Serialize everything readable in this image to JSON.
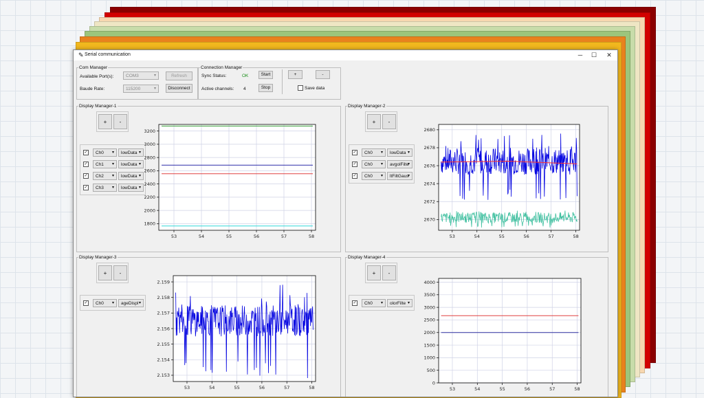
{
  "window": {
    "title": "Serial communication",
    "icon": "feather-icon",
    "minimize": "─",
    "maximize": "☐",
    "close": "✕"
  },
  "com_manager": {
    "legend": "Com Manager",
    "ports_label": "Available Port(s):",
    "port_value": "COM3",
    "refresh": "Refresh",
    "baud_label": "Baude Rate:",
    "baud_value": "115200",
    "disconnect": "Disconnect"
  },
  "connection_manager": {
    "legend": "Connection Manager",
    "sync_label": "Sync Status:",
    "sync_value": "OK",
    "sync_color": "#1a8f1a",
    "start": "Start",
    "channels_label": "Active channels:",
    "channels_value": "4",
    "stop": "Stop",
    "plus": "+",
    "minus": "-",
    "save_label": "Save data",
    "save_checked": false
  },
  "display_managers": [
    {
      "legend": "Display Manager-1",
      "plus": "+",
      "minus": "-",
      "channels": [
        {
          "checked": true,
          "channel": "Ch0",
          "func": "lowData"
        },
        {
          "checked": true,
          "channel": "Ch1",
          "func": "lowData"
        },
        {
          "checked": true,
          "channel": "Ch2",
          "func": "lowData"
        },
        {
          "checked": true,
          "channel": "Ch3",
          "func": "lowData"
        }
      ]
    },
    {
      "legend": "Display Manager-2",
      "plus": "+",
      "minus": "-",
      "channels": [
        {
          "checked": true,
          "channel": "Ch0",
          "func": "lowData"
        },
        {
          "checked": true,
          "channel": "Ch0",
          "func": "avgolFilte"
        },
        {
          "checked": true,
          "channel": "Ch0",
          "func": "ltFiltGaus"
        }
      ]
    },
    {
      "legend": "Display Manager-3",
      "plus": "+",
      "minus": "-",
      "channels": [
        {
          "checked": true,
          "channel": "Ch0",
          "func": "ageDispl"
        }
      ]
    },
    {
      "legend": "Display Manager-4",
      "plus": "+",
      "minus": "-",
      "channels": [
        {
          "checked": true,
          "channel": "Ch0",
          "func": "olorFilte"
        }
      ]
    }
  ],
  "chart_data": [
    {
      "type": "line",
      "x_ticks": [
        53,
        54,
        55,
        56,
        57,
        58
      ],
      "xlim": [
        52.45,
        58.15
      ],
      "y_ticks": [
        1800,
        2000,
        2200,
        2400,
        2600,
        2800,
        3000,
        3200
      ],
      "ylim": [
        1700,
        3300
      ],
      "grid": true,
      "series": [
        {
          "color": "#3aa03a",
          "x": [
            52.55,
            58.05
          ],
          "y": [
            3275,
            3275
          ]
        },
        {
          "color": "#2a2aa8",
          "x": [
            52.55,
            58.05
          ],
          "y": [
            2685,
            2685
          ]
        },
        {
          "color": "#e04040",
          "x": [
            52.55,
            58.05
          ],
          "y": [
            2555,
            2555
          ]
        },
        {
          "color": "#30d8d8",
          "x": [
            52.55,
            58.05
          ],
          "y": [
            1765,
            1765
          ]
        }
      ]
    },
    {
      "type": "line",
      "x_ticks": [
        53,
        54,
        55,
        56,
        57,
        58
      ],
      "xlim": [
        52.45,
        58.15
      ],
      "y_ticks": [
        2670,
        2672,
        2674,
        2676,
        2678,
        2680
      ],
      "ylim": [
        2668.8,
        2680.6
      ],
      "grid": true,
      "series": [
        {
          "color": "#0000e0",
          "style": "noise",
          "x": [
            52.55,
            58.05
          ],
          "y_band": [
            2675.0,
            2678.0
          ],
          "spikes": [
            2672.1,
            2679.6
          ]
        },
        {
          "color": "#ff3030",
          "x": [
            52.55,
            55.3,
            58.05
          ],
          "y": [
            2676.4,
            2676.5,
            2676.2
          ]
        },
        {
          "color": "#40c0a0",
          "style": "noise",
          "x": [
            52.55,
            58.05
          ],
          "y_band": [
            2669.6,
            2670.8
          ],
          "spikes": [
            2669.1,
            2671.1
          ]
        }
      ]
    },
    {
      "type": "line",
      "x_ticks": [
        53,
        54,
        55,
        56,
        57,
        58
      ],
      "xlim": [
        52.45,
        58.15
      ],
      "y_ticks": [
        2.153,
        2.154,
        2.155,
        2.156,
        2.157,
        2.158,
        2.159
      ],
      "ylim": [
        2.1526,
        2.1594
      ],
      "grid": true,
      "series": [
        {
          "color": "#0000e0",
          "style": "noise",
          "x": [
            52.55,
            58.05
          ],
          "y_band": [
            2.1555,
            2.1575
          ],
          "spikes": [
            2.1528,
            2.159
          ]
        }
      ]
    },
    {
      "type": "line",
      "x_ticks": [
        53,
        54,
        55,
        56,
        57,
        58
      ],
      "xlim": [
        52.45,
        58.15
      ],
      "y_ticks": [
        0,
        500,
        1000,
        1500,
        2000,
        2500,
        3000,
        3500,
        4000
      ],
      "ylim": [
        0,
        4150
      ],
      "grid": true,
      "series": [
        {
          "color": "#e04040",
          "x": [
            52.55,
            58.05
          ],
          "y": [
            2670,
            2670
          ]
        },
        {
          "color": "#3030a0",
          "x": [
            52.55,
            58.05
          ],
          "y": [
            2000,
            2000
          ]
        }
      ]
    }
  ]
}
